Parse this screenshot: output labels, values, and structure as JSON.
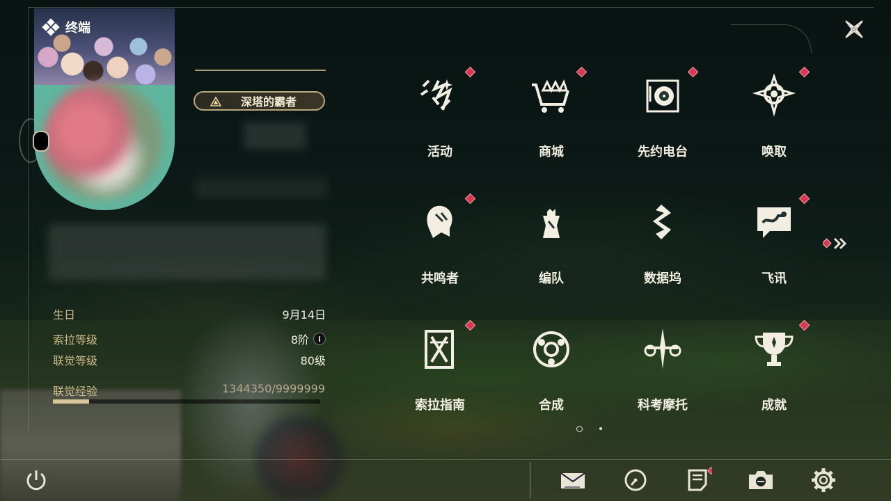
{
  "header": {
    "title": "终端"
  },
  "profile": {
    "title_badge": "深塔的霸者"
  },
  "stats": [
    {
      "key": "生日",
      "value": "9月14日"
    },
    {
      "key": "索拉等级",
      "value": "8阶",
      "info": "i"
    },
    {
      "key": "联觉等级",
      "value": "80级"
    }
  ],
  "experience": {
    "label": "联觉经验",
    "value": "1344350/9999999",
    "fraction": 0.1344
  },
  "grid": [
    {
      "label": "活动",
      "icon": "activity-icon",
      "badge": true
    },
    {
      "label": "商城",
      "icon": "shop-icon",
      "badge": true
    },
    {
      "label": "先约电台",
      "icon": "radio-icon",
      "badge": true
    },
    {
      "label": "唤取",
      "icon": "convene-icon",
      "badge": true
    },
    {
      "label": "共鸣者",
      "icon": "resonator-icon",
      "badge": true
    },
    {
      "label": "编队",
      "icon": "team-icon",
      "badge": false
    },
    {
      "label": "数据坞",
      "icon": "data-bank-icon",
      "badge": false
    },
    {
      "label": "飞讯",
      "icon": "chat-icon",
      "badge": true
    },
    {
      "label": "索拉指南",
      "icon": "guidebook-icon",
      "badge": true
    },
    {
      "label": "合成",
      "icon": "synthesis-icon",
      "badge": false
    },
    {
      "label": "科考摩托",
      "icon": "motorcycle-icon",
      "badge": false
    },
    {
      "label": "成就",
      "icon": "achievement-icon",
      "badge": true
    }
  ],
  "pager": {
    "pages": 2,
    "current": 1
  },
  "bottom_bar": [
    {
      "icon": "power-icon"
    },
    {
      "icon": "mail-icon"
    },
    {
      "icon": "clock-icon"
    },
    {
      "icon": "notes-icon",
      "badge": true
    },
    {
      "icon": "camera-icon"
    },
    {
      "icon": "settings-icon"
    }
  ],
  "colors": {
    "accent": "#d8c69a",
    "badge": "#d43b53",
    "label": "#cdb98a"
  }
}
